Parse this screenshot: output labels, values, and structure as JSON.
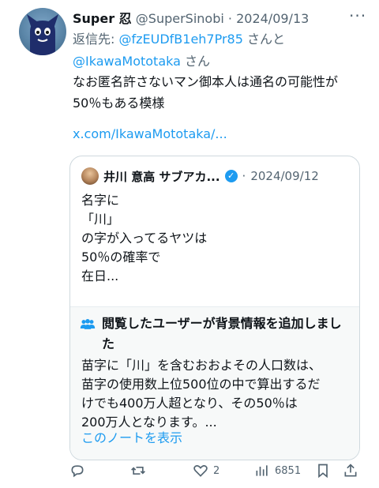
{
  "tweet": {
    "display_name": "Super 忍",
    "handle": "@SuperSinobi",
    "separator": "·",
    "date": "2024/09/13",
    "reply_prefix": "返信先: ",
    "reply_user1": "@fzEUDfB1eh7Pr85",
    "reply_and": " さんと",
    "reply_user2": "@IkawaMototaka",
    "reply_san": " さん",
    "text_line1": "なお匿名許さないマン御本人は通名の可能性が",
    "text_line2": "50％もある模様",
    "url": "x.com/IkawaMototaka/..."
  },
  "quote": {
    "display_name": "井川 意高 サブアカ...",
    "separator": "·",
    "date": "2024/09/12",
    "lines": [
      "名字に",
      "「川」",
      "の字が入ってるヤツは",
      "50％の確率で",
      "在日..."
    ]
  },
  "note": {
    "title": "閲覧したユーザーが背景情報を追加しました",
    "lines": [
      "苗字に「川」を含むおおよその人口数は、",
      "苗字の使用数上位500位の中で算出するだ",
      "けでも400万人超となり、その50％は",
      "200万人となります。..."
    ],
    "link": "このノートを表示"
  },
  "actions": {
    "reply_icon": "reply-icon",
    "retweet_icon": "retweet-icon",
    "like_icon": "heart-icon",
    "like_count": "2",
    "views_icon": "views-icon",
    "views_count": "6851",
    "bookmark_icon": "bookmark-icon",
    "share_icon": "share-icon"
  },
  "colors": {
    "link": "#1d9bf0",
    "muted": "#536471",
    "text": "#0f1419",
    "border": "#cfd9de",
    "note_bg": "#f7f9f9"
  }
}
